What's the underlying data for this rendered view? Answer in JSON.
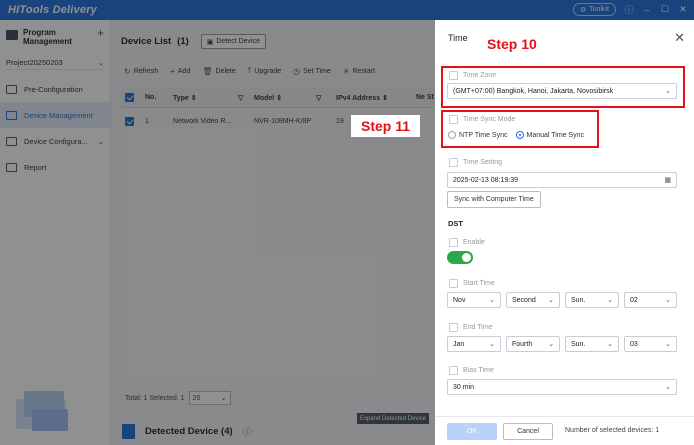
{
  "app": {
    "title": "HITools Delivery",
    "toolkit_label": "Toolkit"
  },
  "sidebar": {
    "program_title": "Program Management",
    "project": "Project20250203",
    "items": [
      {
        "label": "Pre-Configuration",
        "icon": "gear-icon"
      },
      {
        "label": "Device Management",
        "icon": "device-icon",
        "active": true
      },
      {
        "label": "Device Configura...",
        "icon": "config-icon"
      },
      {
        "label": "Report",
        "icon": "report-icon"
      }
    ]
  },
  "device_list": {
    "title": "Device List",
    "count": "(1)",
    "detect_button": "Detect Device",
    "toolbar": [
      "Refresh",
      "Add",
      "Delete",
      "Upgrade",
      "Set Time",
      "Restart"
    ],
    "columns": [
      "No.",
      "Type",
      "Model",
      "IPv4 Address",
      "Ne St"
    ],
    "rows": [
      {
        "no": "1",
        "type": "Network Video R...",
        "model": "NVR-108MH-K/8P",
        "ip": "19"
      }
    ],
    "pager_text": "Total: 1  Selected: 1",
    "page_size": "20",
    "expand_label": "Expand Detected Device",
    "detected_title": "Detected Device",
    "detected_count": "(4)"
  },
  "time_drawer": {
    "title": "Time",
    "time_zone_label": "Time Zone",
    "time_zone_value": "(GMT+07:00) Bangkok, Hanoi, Jakarta, Novosibirsk",
    "sync_mode_label": "Time Sync Mode",
    "sync_options": [
      "NTP Time Sync",
      "Manual Time Sync"
    ],
    "time_setting_label": "Time Setting",
    "time_value": "2025-02-13 08:19:39",
    "sync_computer_button": "Sync with Computer Time",
    "dst_label": "DST",
    "enable_label": "Enable",
    "start_time_label": "Start Time",
    "start_time": [
      "Nov",
      "Second",
      "Sun.",
      "02"
    ],
    "end_time_label": "End Time",
    "end_time": [
      "Jan",
      "Fourth",
      "Sun.",
      "03"
    ],
    "bias_time_label": "Bias Time",
    "bias_time": "30 min",
    "ok_button": "OK",
    "cancel_button": "Cancel",
    "selected_devices": "Number of selected devices: 1"
  },
  "annotations": {
    "step10": "Step 10",
    "step11": "Step 11",
    "color": "#e3111a"
  }
}
